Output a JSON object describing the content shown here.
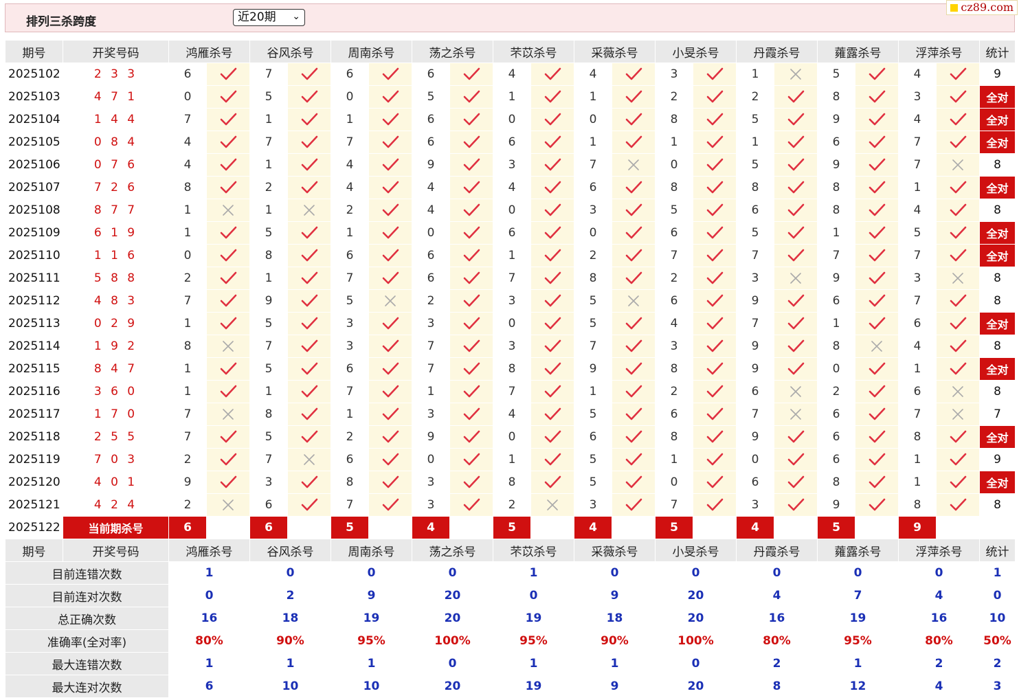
{
  "header": {
    "title": "排列三杀跨度",
    "period_select": "近20期",
    "logo": "cz89.com"
  },
  "columns": {
    "period": "期号",
    "draw": "开奖号码",
    "experts": [
      "鸿雁杀号",
      "谷风杀号",
      "周南杀号",
      "荡之杀号",
      "芣苡杀号",
      "采薇杀号",
      "小旻杀号",
      "丹霞杀号",
      "蕹露杀号",
      "浮萍杀号"
    ],
    "summary": "统计"
  },
  "rows": [
    {
      "period": "2025102",
      "draw": "2 3 3",
      "kills": [
        6,
        7,
        6,
        6,
        4,
        4,
        3,
        1,
        5,
        4
      ],
      "ok": [
        1,
        1,
        1,
        1,
        1,
        1,
        1,
        0,
        1,
        1
      ],
      "sum": "9"
    },
    {
      "period": "2025103",
      "draw": "4 7 1",
      "kills": [
        0,
        5,
        0,
        5,
        1,
        1,
        2,
        2,
        8,
        3
      ],
      "ok": [
        1,
        1,
        1,
        1,
        1,
        1,
        1,
        1,
        1,
        1
      ],
      "sum": "全对"
    },
    {
      "period": "2025104",
      "draw": "1 4 4",
      "kills": [
        7,
        1,
        1,
        6,
        0,
        0,
        8,
        5,
        9,
        4
      ],
      "ok": [
        1,
        1,
        1,
        1,
        1,
        1,
        1,
        1,
        1,
        1
      ],
      "sum": "全对"
    },
    {
      "period": "2025105",
      "draw": "0 8 4",
      "kills": [
        4,
        7,
        7,
        6,
        6,
        1,
        1,
        1,
        6,
        7
      ],
      "ok": [
        1,
        1,
        1,
        1,
        1,
        1,
        1,
        1,
        1,
        1
      ],
      "sum": "全对"
    },
    {
      "period": "2025106",
      "draw": "0 7 6",
      "kills": [
        4,
        1,
        4,
        9,
        3,
        7,
        0,
        5,
        9,
        7
      ],
      "ok": [
        1,
        1,
        1,
        1,
        1,
        0,
        1,
        1,
        1,
        0
      ],
      "sum": "8"
    },
    {
      "period": "2025107",
      "draw": "7 2 6",
      "kills": [
        8,
        2,
        4,
        4,
        4,
        6,
        8,
        8,
        8,
        1
      ],
      "ok": [
        1,
        1,
        1,
        1,
        1,
        1,
        1,
        1,
        1,
        1
      ],
      "sum": "全对"
    },
    {
      "period": "2025108",
      "draw": "8 7 7",
      "kills": [
        1,
        1,
        2,
        4,
        0,
        3,
        5,
        6,
        8,
        4
      ],
      "ok": [
        0,
        0,
        1,
        1,
        1,
        1,
        1,
        1,
        1,
        1
      ],
      "sum": "8"
    },
    {
      "period": "2025109",
      "draw": "6 1 9",
      "kills": [
        1,
        5,
        1,
        0,
        6,
        0,
        6,
        5,
        1,
        5
      ],
      "ok": [
        1,
        1,
        1,
        1,
        1,
        1,
        1,
        1,
        1,
        1
      ],
      "sum": "全对"
    },
    {
      "period": "2025110",
      "draw": "1 1 6",
      "kills": [
        0,
        8,
        6,
        6,
        1,
        2,
        7,
        7,
        7,
        7
      ],
      "ok": [
        1,
        1,
        1,
        1,
        1,
        1,
        1,
        1,
        1,
        1
      ],
      "sum": "全对"
    },
    {
      "period": "2025111",
      "draw": "5 8 8",
      "kills": [
        2,
        1,
        7,
        6,
        7,
        8,
        2,
        3,
        9,
        3
      ],
      "ok": [
        1,
        1,
        1,
        1,
        1,
        1,
        1,
        0,
        1,
        0
      ],
      "sum": "8"
    },
    {
      "period": "2025112",
      "draw": "4 8 3",
      "kills": [
        7,
        9,
        5,
        2,
        3,
        5,
        6,
        9,
        6,
        7
      ],
      "ok": [
        1,
        1,
        0,
        1,
        1,
        0,
        1,
        1,
        1,
        1
      ],
      "sum": "8"
    },
    {
      "period": "2025113",
      "draw": "0 2 9",
      "kills": [
        1,
        5,
        3,
        3,
        0,
        5,
        4,
        7,
        1,
        6
      ],
      "ok": [
        1,
        1,
        1,
        1,
        1,
        1,
        1,
        1,
        1,
        1
      ],
      "sum": "全对"
    },
    {
      "period": "2025114",
      "draw": "1 9 2",
      "kills": [
        8,
        7,
        3,
        7,
        3,
        7,
        3,
        9,
        8,
        4
      ],
      "ok": [
        0,
        1,
        1,
        1,
        1,
        1,
        1,
        1,
        0,
        1
      ],
      "sum": "8"
    },
    {
      "period": "2025115",
      "draw": "8 4 7",
      "kills": [
        1,
        5,
        6,
        7,
        8,
        9,
        8,
        9,
        0,
        1
      ],
      "ok": [
        1,
        1,
        1,
        1,
        1,
        1,
        1,
        1,
        1,
        1
      ],
      "sum": "全对"
    },
    {
      "period": "2025116",
      "draw": "3 6 0",
      "kills": [
        1,
        1,
        7,
        1,
        7,
        1,
        2,
        6,
        2,
        6
      ],
      "ok": [
        1,
        1,
        1,
        1,
        1,
        1,
        1,
        0,
        1,
        0
      ],
      "sum": "8"
    },
    {
      "period": "2025117",
      "draw": "1 7 0",
      "kills": [
        7,
        8,
        1,
        3,
        4,
        5,
        6,
        7,
        6,
        7
      ],
      "ok": [
        0,
        1,
        1,
        1,
        1,
        1,
        1,
        0,
        1,
        0
      ],
      "sum": "7"
    },
    {
      "period": "2025118",
      "draw": "2 5 5",
      "kills": [
        7,
        5,
        2,
        9,
        0,
        6,
        8,
        9,
        6,
        8
      ],
      "ok": [
        1,
        1,
        1,
        1,
        1,
        1,
        1,
        1,
        1,
        1
      ],
      "sum": "全对"
    },
    {
      "period": "2025119",
      "draw": "7 0 3",
      "kills": [
        2,
        7,
        6,
        0,
        1,
        5,
        1,
        0,
        6,
        1
      ],
      "ok": [
        1,
        0,
        1,
        1,
        1,
        1,
        1,
        1,
        1,
        1
      ],
      "sum": "9"
    },
    {
      "period": "2025120",
      "draw": "4 0 1",
      "kills": [
        9,
        3,
        8,
        3,
        8,
        5,
        0,
        6,
        8,
        1
      ],
      "ok": [
        1,
        1,
        1,
        1,
        1,
        1,
        1,
        1,
        1,
        1
      ],
      "sum": "全对"
    },
    {
      "period": "2025121",
      "draw": "4 2 4",
      "kills": [
        2,
        6,
        7,
        3,
        2,
        3,
        7,
        3,
        9,
        8
      ],
      "ok": [
        0,
        1,
        1,
        1,
        0,
        1,
        1,
        1,
        1,
        1
      ],
      "sum": "8"
    }
  ],
  "current": {
    "period": "2025122",
    "label": "当前期杀号",
    "kills": [
      6,
      6,
      5,
      4,
      5,
      4,
      5,
      4,
      5,
      9
    ]
  },
  "stats": [
    {
      "label": "目前连错次数",
      "values": [
        "1",
        "0",
        "0",
        "0",
        "1",
        "0",
        "0",
        "0",
        "0",
        "0"
      ],
      "sum": "1",
      "pct": false
    },
    {
      "label": "目前连对次数",
      "values": [
        "0",
        "2",
        "9",
        "20",
        "0",
        "9",
        "20",
        "4",
        "7",
        "4"
      ],
      "sum": "0",
      "pct": false
    },
    {
      "label": "总正确次数",
      "values": [
        "16",
        "18",
        "19",
        "20",
        "19",
        "18",
        "20",
        "16",
        "19",
        "16"
      ],
      "sum": "10",
      "pct": false
    },
    {
      "label": "准确率(全对率)",
      "values": [
        "80%",
        "90%",
        "95%",
        "100%",
        "95%",
        "90%",
        "100%",
        "80%",
        "95%",
        "80%"
      ],
      "sum": "50%",
      "pct": true
    },
    {
      "label": "最大连错次数",
      "values": [
        "1",
        "1",
        "1",
        "0",
        "1",
        "1",
        "0",
        "2",
        "1",
        "2"
      ],
      "sum": "2",
      "pct": false
    },
    {
      "label": "最大连对次数",
      "values": [
        "6",
        "10",
        "10",
        "20",
        "19",
        "9",
        "20",
        "8",
        "12",
        "4"
      ],
      "sum": "3",
      "pct": false
    }
  ],
  "colors": {
    "accent": "#d01010",
    "stat_blue": "#1a2fb5",
    "header_bg": "#e9e9e9",
    "mark_bg": "#fdf8e0",
    "topbar_bg": "#fbe9ea"
  },
  "icons": {
    "correct": "check-icon",
    "wrong": "cross-icon",
    "logo_mark": "yellow-square-icon"
  }
}
